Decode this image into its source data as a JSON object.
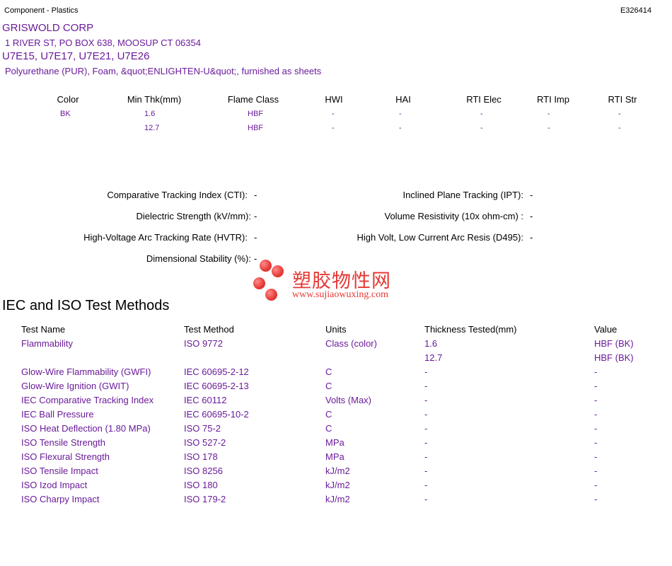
{
  "header": {
    "category": "Component - Plastics",
    "file_number": "E326414"
  },
  "company": {
    "name": "GRISWOLD CORP",
    "address": "1 RIVER ST, PO BOX 638, MOOSUP CT   06354",
    "models": "U7E15, U7E17, U7E21, U7E26",
    "material": "Polyurethane (PUR), Foam, &quot;ENLIGHTEN-U&quot;, furnished as sheets"
  },
  "rating_table": {
    "headers": [
      "Color",
      "Min Thk(mm)",
      "Flame Class",
      "HWI",
      "HAI",
      "RTI Elec",
      "RTI Imp",
      "RTI Str"
    ],
    "rows": [
      [
        "BK",
        "1.6",
        "HBF",
        "-",
        "-",
        "-",
        "-",
        "-"
      ],
      [
        "",
        "12.7",
        "HBF",
        "-",
        "-",
        "-",
        "-",
        "-"
      ]
    ]
  },
  "properties": {
    "left": [
      {
        "label": "Comparative Tracking Index (CTI):",
        "value": "-"
      },
      {
        "label": "Dielectric Strength (kV/mm):",
        "value": "-"
      },
      {
        "label": "High-Voltage Arc Tracking Rate (HVTR):",
        "value": "-"
      },
      {
        "label": "Dimensional Stability (%):",
        "value": "-"
      }
    ],
    "right": [
      {
        "label": "Inclined Plane Tracking (IPT):",
        "value": "-"
      },
      {
        "label": "Volume Resistivity (10x ohm-cm) :",
        "value": "-"
      },
      {
        "label": "High Volt, Low Current Arc Resis (D495):",
        "value": "-"
      }
    ]
  },
  "watermark": {
    "chinese": "塑胶物性网",
    "url": "www.sujiaowuxing.com",
    "color": "#e53935"
  },
  "iec_section": {
    "title": "IEC and ISO Test Methods",
    "headers": [
      "Test Name",
      "Test Method",
      "Units",
      "Thickness Tested(mm)",
      "Value"
    ],
    "rows": [
      [
        "Flammability",
        "ISO 9772",
        "Class (color)",
        "1.6",
        "HBF (BK)"
      ],
      [
        "",
        "",
        "",
        "12.7",
        "HBF (BK)"
      ],
      [
        "Glow-Wire Flammability (GWFI)",
        "IEC 60695-2-12",
        "C",
        "-",
        "-"
      ],
      [
        "Glow-Wire Ignition (GWIT)",
        "IEC 60695-2-13",
        "C",
        "-",
        "-"
      ],
      [
        "IEC Comparative Tracking Index",
        "IEC 60112",
        "Volts (Max)",
        "-",
        "-"
      ],
      [
        "IEC Ball Pressure",
        "IEC 60695-10-2",
        "C",
        "-",
        "-"
      ],
      [
        "ISO Heat Deflection (1.80 MPa)",
        "ISO 75-2",
        "C",
        "-",
        "-"
      ],
      [
        "ISO Tensile Strength",
        "ISO 527-2",
        "MPa",
        "-",
        "-"
      ],
      [
        "ISO Flexural Strength",
        "ISO 178",
        "MPa",
        "-",
        "-"
      ],
      [
        "ISO Tensile Impact",
        "ISO 8256",
        "kJ/m2",
        "-",
        "-"
      ],
      [
        "ISO Izod Impact",
        "ISO 180",
        "kJ/m2",
        "-",
        "-"
      ],
      [
        "ISO Charpy Impact",
        "ISO 179-2",
        "kJ/m2",
        "-",
        "-"
      ]
    ]
  },
  "colors": {
    "value_text": "#6a1b9a",
    "label_text": "#000000"
  }
}
